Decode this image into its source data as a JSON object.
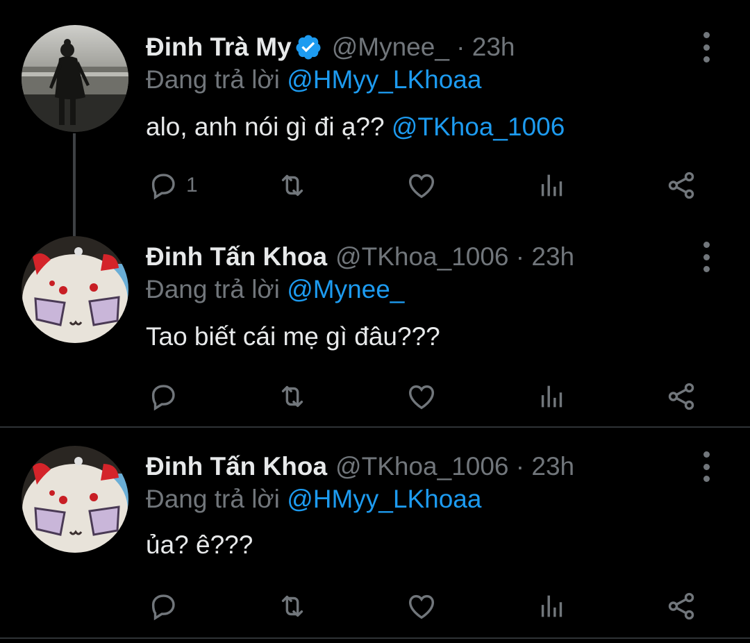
{
  "tweets": [
    {
      "author_name": "Đinh Trà My",
      "verified": true,
      "handle_time": "@Mynee_ · 23h",
      "replying_prefix": "Đang trả lời ",
      "replying_to": "@HMyy_LKhoaa",
      "text": "alo, anh nói gì đi ạ?? ",
      "text_mention": "@TKhoa_1006",
      "reply_count": "1",
      "avatar_icon": "beach-silhouette-avatar"
    },
    {
      "author_name": "Đinh Tấn Khoa",
      "verified": false,
      "handle_time": "@TKhoa_1006 · 23h",
      "replying_prefix": "Đang trả lời ",
      "replying_to": "@Mynee_",
      "text": "Tao biết cái mẹ gì đâu???",
      "reply_count": "",
      "avatar_icon": "plush-toy-avatar"
    },
    {
      "author_name": "Đinh Tấn Khoa",
      "verified": false,
      "handle_time": "@TKhoa_1006 · 23h",
      "replying_prefix": "Đang trả lời ",
      "replying_to": "@HMyy_LKhoaa",
      "text": "ủa? ê???",
      "reply_count": "",
      "avatar_icon": "plush-toy-avatar"
    }
  ],
  "icons": [
    "reply-icon",
    "retweet-icon",
    "like-icon",
    "analytics-icon",
    "share-icon",
    "more-options-icon",
    "verified-badge-icon"
  ],
  "colors": {
    "background": "#000000",
    "text": "#e7e9ea",
    "muted": "#71767b",
    "accent": "#1d9bf0",
    "divider": "#2f3336"
  }
}
